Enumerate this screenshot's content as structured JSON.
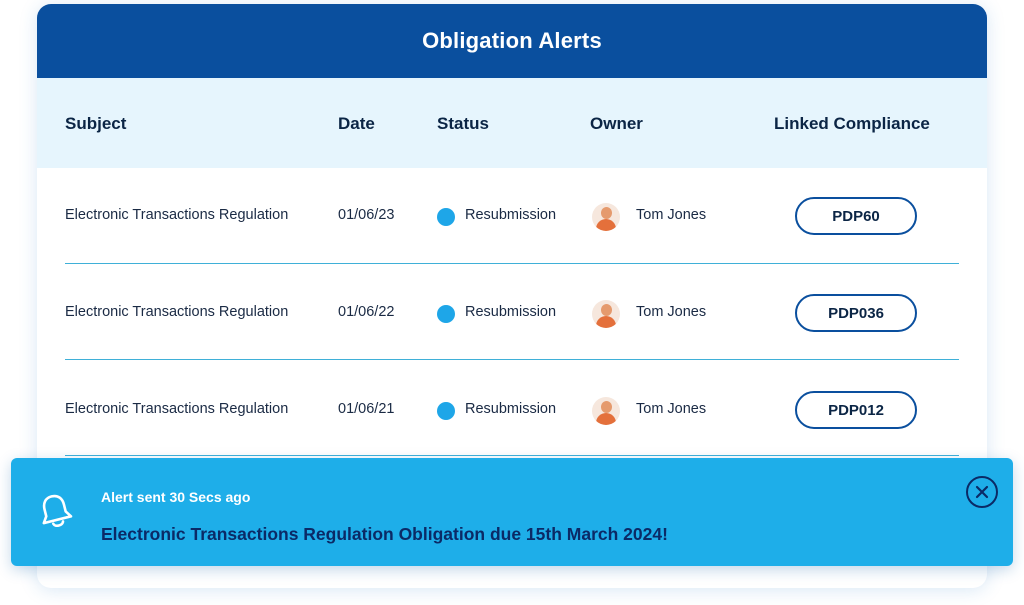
{
  "card": {
    "title": "Obligation Alerts",
    "columns": {
      "subject": "Subject",
      "date": "Date",
      "status": "Status",
      "owner": "Owner",
      "linked": "Linked Compliance"
    },
    "rows": [
      {
        "subject": "Electronic Transactions Regulation",
        "date": "01/06/23",
        "status": "Resubmission",
        "owner": "Tom Jones",
        "linked": "PDP60"
      },
      {
        "subject": "Electronic Transactions Regulation",
        "date": "01/06/22",
        "status": "Resubmission",
        "owner": "Tom Jones",
        "linked": "PDP036"
      },
      {
        "subject": "Electronic Transactions Regulation",
        "date": "01/06/21",
        "status": "Resubmission",
        "owner": "Tom Jones",
        "linked": "PDP012"
      }
    ]
  },
  "toast": {
    "subtitle": "Alert sent 30 Secs ago",
    "message": "Electronic Transactions Regulation Obligation due 15th March 2024!",
    "icon": "bell-icon",
    "close_icon": "close-icon"
  },
  "colors": {
    "header_bg": "#0a4f9e",
    "column_header_bg": "#e6f5fd",
    "status_dot": "#1ea6e8",
    "toast_bg": "#1eaee9",
    "toast_text": "#0b2a66"
  }
}
